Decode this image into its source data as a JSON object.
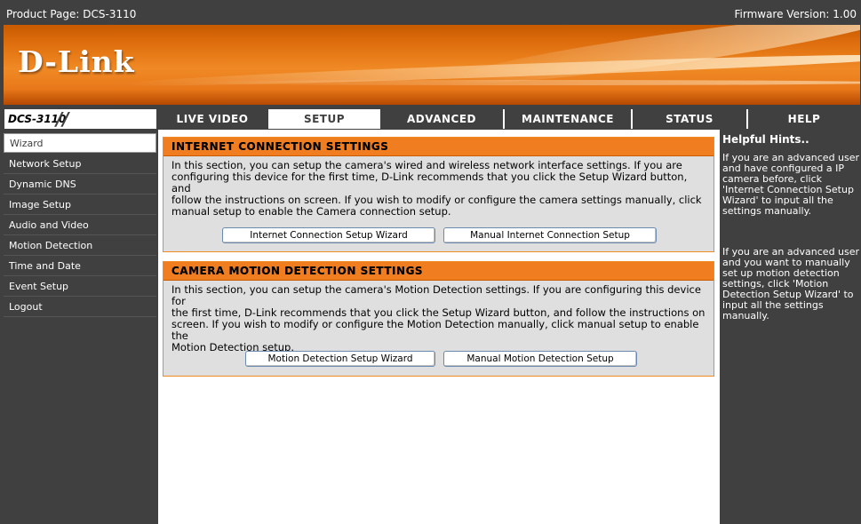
{
  "topbar": {
    "product": "Product Page: DCS-3110",
    "firmware": "Firmware Version: 1.00"
  },
  "banner": {
    "logo": "D-Link"
  },
  "nav": {
    "model": "DCS-3110",
    "tabs": [
      {
        "label": "LIVE VIDEO",
        "active": false
      },
      {
        "label": "SETUP",
        "active": true
      },
      {
        "label": "ADVANCED",
        "active": false
      },
      {
        "label": "MAINTENANCE",
        "active": false
      },
      {
        "label": "STATUS",
        "active": false
      },
      {
        "label": "HELP",
        "active": false
      }
    ]
  },
  "sidebar": {
    "items": [
      {
        "label": "Wizard",
        "active": true
      },
      {
        "label": "Network Setup",
        "active": false
      },
      {
        "label": "Dynamic DNS",
        "active": false
      },
      {
        "label": "Image Setup",
        "active": false
      },
      {
        "label": "Audio and Video",
        "active": false
      },
      {
        "label": "Motion Detection",
        "active": false
      },
      {
        "label": "Time and Date",
        "active": false
      },
      {
        "label": "Event Setup",
        "active": false
      },
      {
        "label": "Logout",
        "active": false
      }
    ]
  },
  "internet": {
    "title": "INTERNET CONNECTION SETTINGS",
    "line1": "In this section, you can setup the camera's wired and wireless network interface settings. If you are",
    "line2": "configuring this device for the first time, D-Link recommends that you click the Setup Wizard button, and",
    "line3": "follow the instructions on screen. If you wish to modify or configure the camera settings manually, click",
    "line4": "manual setup to enable the Camera connection setup.",
    "wizard_button": "Internet Connection Setup Wizard",
    "manual_button": "Manual Internet Connection Setup"
  },
  "motion": {
    "title": "CAMERA MOTION DETECTION SETTINGS",
    "line1": "In this section, you can setup the camera's Motion Detection settings. If you are configuring this device for",
    "line2": "the first time, D-Link recommends that you click the Setup Wizard button, and follow the instructions on",
    "line3": "screen. If you wish to modify or configure the Motion Detection manually, click manual setup to enable the",
    "line4": "Motion Detection setup.",
    "wizard_button": "Motion Detection Setup Wizard",
    "manual_button": "Manual Motion Detection Setup"
  },
  "hints": {
    "title": "Helpful Hints..",
    "p1": [
      "If you are an advanced user",
      "and have configured a IP",
      "camera before, click",
      "'Internet Connection Setup",
      "Wizard' to input all the",
      "settings manually."
    ],
    "p2": [
      "If you are an advanced user",
      "and you want to manually",
      "set up motion detection",
      "settings, click 'Motion",
      "Detection Setup Wizard' to",
      "input all the settings",
      "manually."
    ]
  },
  "colors": {
    "dark": "#404040",
    "orange": "#f07d1f",
    "panel": "#dfdfdf"
  }
}
